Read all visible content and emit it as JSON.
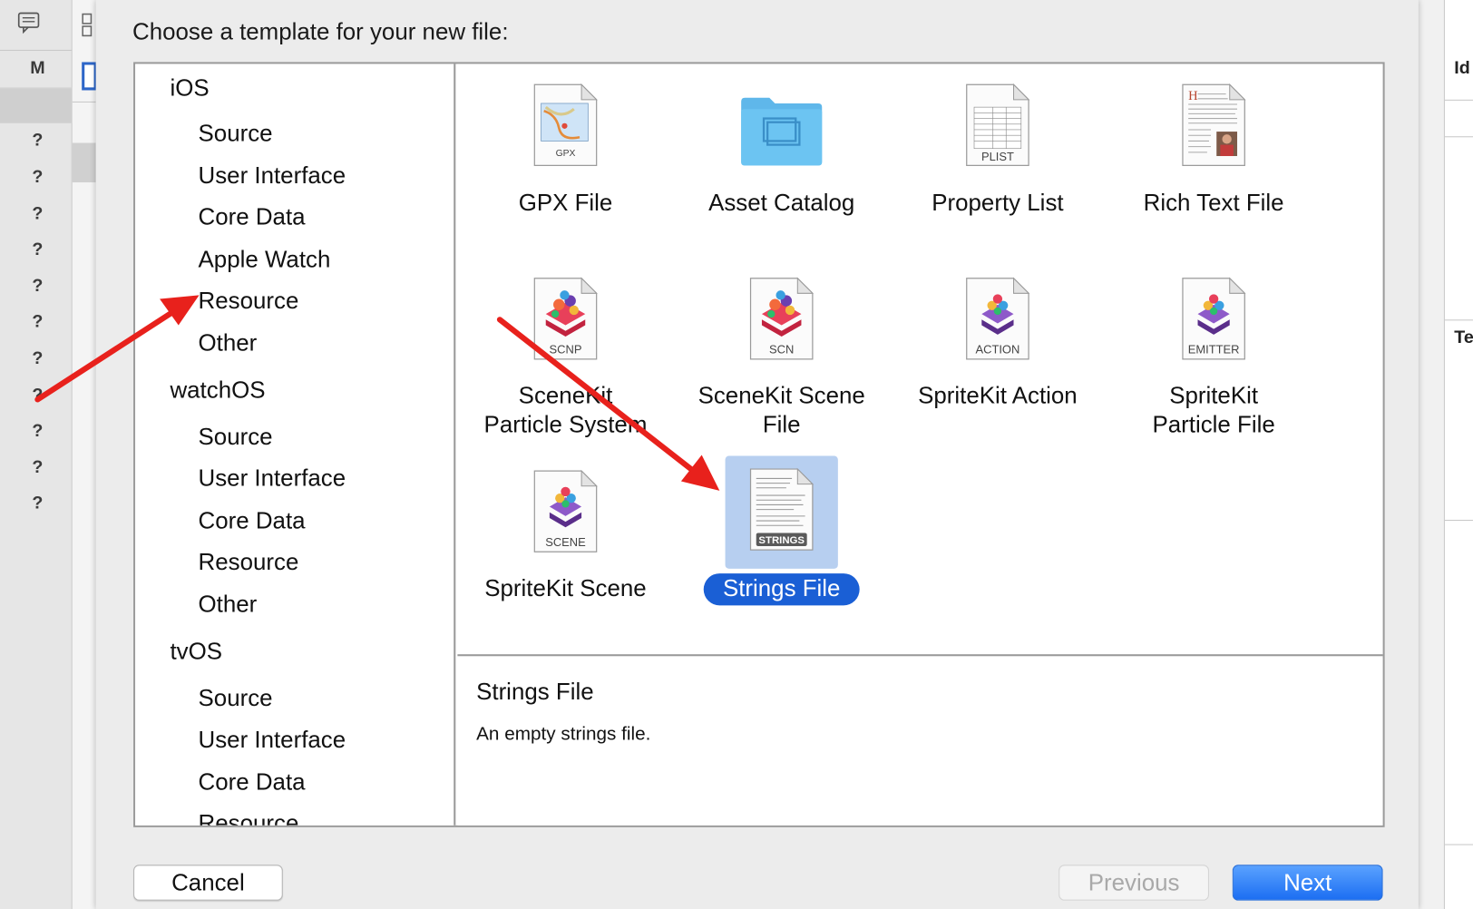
{
  "window": {
    "title": "Choose a template for your new file:"
  },
  "background": {
    "left_marks": [
      "M",
      "?",
      "?",
      "?",
      "?",
      "?",
      "?",
      "?",
      "?",
      "?",
      "?",
      "?"
    ],
    "right_labels": [
      "Id",
      "Te"
    ]
  },
  "sidebar": {
    "sections": [
      {
        "name": "iOS",
        "items": [
          "Source",
          "User Interface",
          "Core Data",
          "Apple Watch",
          "Resource",
          "Other"
        ]
      },
      {
        "name": "watchOS",
        "items": [
          "Source",
          "User Interface",
          "Core Data",
          "Resource",
          "Other"
        ]
      },
      {
        "name": "tvOS",
        "items": [
          "Source",
          "User Interface",
          "Core Data",
          "Resource"
        ]
      }
    ]
  },
  "templates": [
    {
      "label": "GPX File",
      "tag": "GPX",
      "icon": "gpx-file-icon"
    },
    {
      "label": "Asset Catalog",
      "tag": "",
      "icon": "folder-icon"
    },
    {
      "label": "Property List",
      "tag": "PLIST",
      "icon": "plist-file-icon"
    },
    {
      "label": "Rich Text File",
      "tag": "",
      "icon": "rtf-file-icon"
    },
    {
      "label": "SceneKit Particle System",
      "line1": "SceneKit",
      "line2": "Particle System",
      "tag": "SCNP",
      "icon": "scenekit-particle-icon"
    },
    {
      "label": "SceneKit Scene File",
      "line1": "SceneKit Scene",
      "line2": "File",
      "tag": "SCN",
      "icon": "scenekit-scene-icon"
    },
    {
      "label": "SpriteKit Action",
      "tag": "ACTION",
      "icon": "spritekit-action-icon"
    },
    {
      "label": "SpriteKit Particle File",
      "line1": "SpriteKit",
      "line2": "Particle File",
      "tag": "EMITTER",
      "icon": "spritekit-emitter-icon"
    },
    {
      "label": "SpriteKit Scene",
      "tag": "SCENE",
      "icon": "spritekit-scene-icon"
    },
    {
      "label": "Strings File",
      "tag": "STRINGS",
      "icon": "strings-file-icon",
      "selected": true
    }
  ],
  "selected_description": {
    "title": "Strings File",
    "text": "An empty strings file."
  },
  "buttons": {
    "cancel": "Cancel",
    "previous": "Previous",
    "next": "Next"
  },
  "colors": {
    "accent": "#1a5fd5",
    "selection_bg": "#b7cff0",
    "arrow": "#e8211c"
  }
}
